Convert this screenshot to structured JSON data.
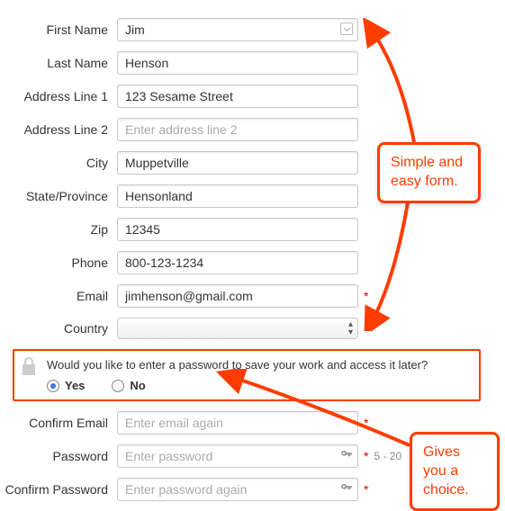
{
  "fields": {
    "first_name": {
      "label": "First Name",
      "value": "Jim",
      "placeholder": ""
    },
    "last_name": {
      "label": "Last Name",
      "value": "Henson",
      "placeholder": ""
    },
    "address1": {
      "label": "Address Line 1",
      "value": "123 Sesame Street",
      "placeholder": ""
    },
    "address2": {
      "label": "Address Line 2",
      "value": "",
      "placeholder": "Enter address line 2"
    },
    "city": {
      "label": "City",
      "value": "Muppetville",
      "placeholder": ""
    },
    "state": {
      "label": "State/Province",
      "value": "Hensonland",
      "placeholder": ""
    },
    "zip": {
      "label": "Zip",
      "value": "12345",
      "placeholder": ""
    },
    "phone": {
      "label": "Phone",
      "value": "800-123-1234",
      "placeholder": ""
    },
    "email": {
      "label": "Email",
      "value": "jimhenson@gmail.com",
      "placeholder": ""
    },
    "country": {
      "label": "Country",
      "value": ""
    },
    "confirm_email": {
      "label": "Confirm Email",
      "value": "",
      "placeholder": "Enter email again"
    },
    "password": {
      "label": "Password",
      "value": "",
      "placeholder": "Enter password",
      "hint": "5 - 20"
    },
    "confirm_password": {
      "label": "Confirm Password",
      "value": "",
      "placeholder": "Enter password again"
    }
  },
  "required_marker": "*",
  "password_section": {
    "question": "Would you like to enter a password to save your work and access it later?",
    "yes": "Yes",
    "no": "No",
    "selected": "yes"
  },
  "callouts": {
    "c1": "Simple and easy form.",
    "c2": "Gives you a choice."
  }
}
